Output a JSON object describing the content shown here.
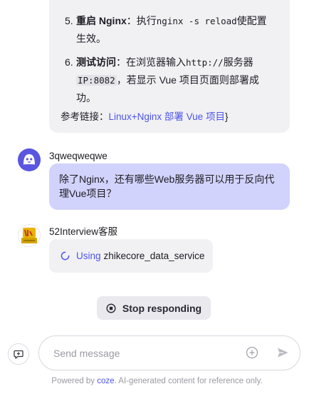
{
  "previous_message": {
    "steps": [
      {
        "number": "5.",
        "title": "重启 Nginx",
        "colon": "：",
        "pre": "执行",
        "code": "nginx -s reload",
        "post": "使配置生效。"
      },
      {
        "number": "6.",
        "title": "测试访问",
        "colon": "：",
        "pre": "在浏览器输入",
        "code": "http://",
        "mid": "服务器",
        "code2": "IP:8082",
        "post": "，若显示 Vue 项目页面则部署成功。"
      }
    ],
    "reference": {
      "label": "参考链接：",
      "link_text": "Linux+Nginx 部署 Vue 项目",
      "suffix": "}"
    }
  },
  "user_message": {
    "sender": "3qweqweqwe",
    "text": "除了Nginx，还有哪些Web服务器可以用于反向代理Vue项目？"
  },
  "bot_message": {
    "sender": "52Interview客服",
    "status_label": "Using",
    "status_tool": "zhikecore_data_service"
  },
  "stop_button": {
    "label": "Stop responding"
  },
  "composer": {
    "placeholder": "Send message"
  },
  "footer": {
    "prefix": "Powered by ",
    "brand": "coze",
    "suffix": ". AI-generated content for reference only."
  },
  "colors": {
    "accent": "#4d53e8",
    "user_bubble": "#d2d3fc",
    "bot_bubble": "#f1f1f4"
  }
}
